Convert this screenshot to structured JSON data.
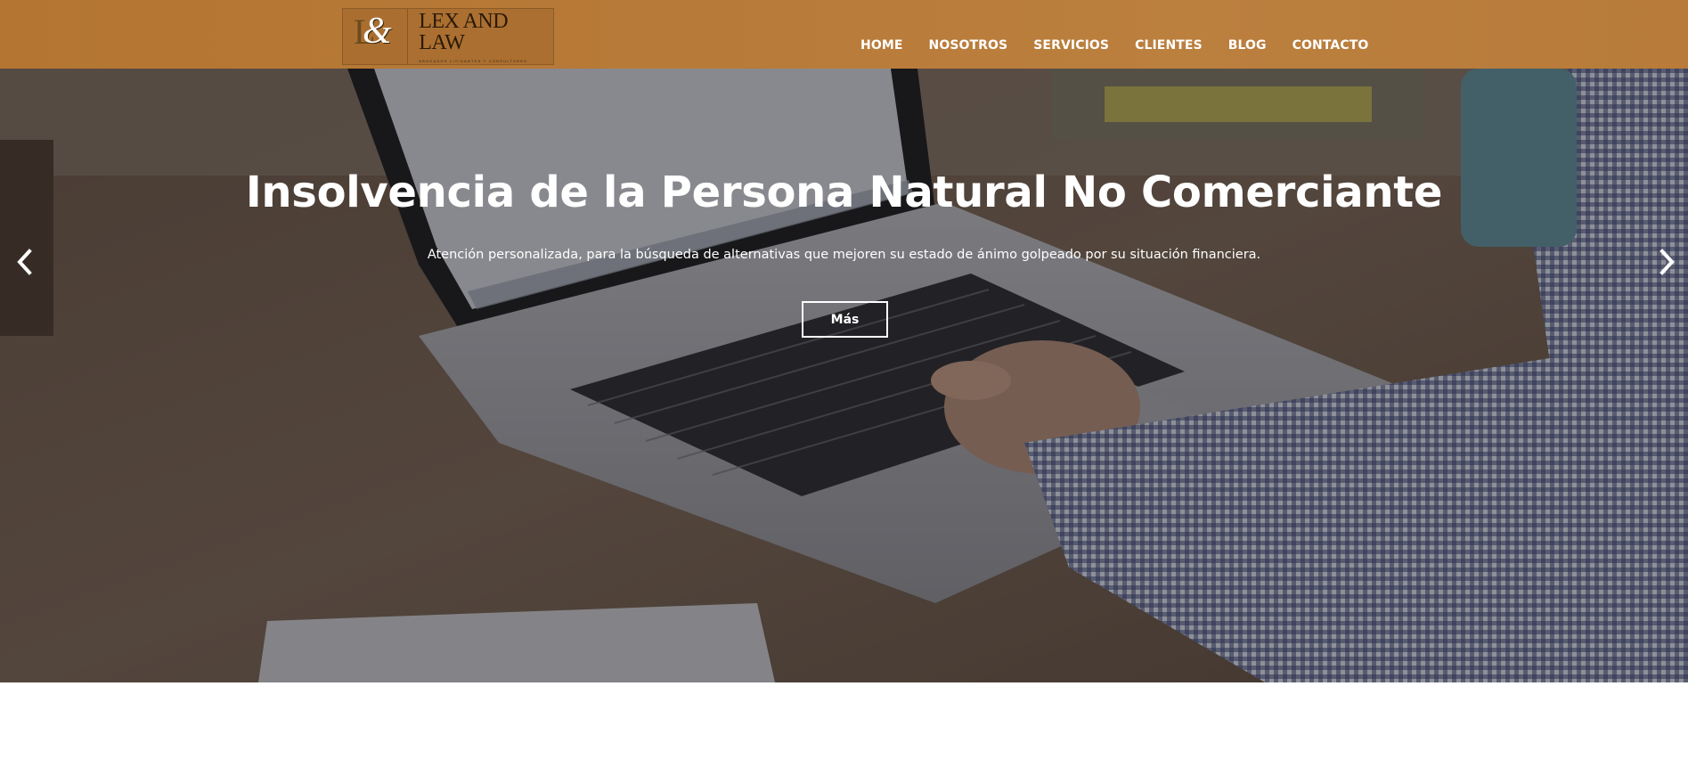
{
  "header": {
    "logo": {
      "monogram": "L&",
      "name": "LEX AND LAW",
      "tagline": "ABOGADOS LITIGANTES Y CONSULTORES"
    },
    "nav": [
      {
        "label": "HOME"
      },
      {
        "label": "NOSOTROS"
      },
      {
        "label": "SERVICIOS"
      },
      {
        "label": "CLIENTES"
      },
      {
        "label": "BLOG"
      },
      {
        "label": "CONTACTO"
      }
    ]
  },
  "hero": {
    "title": "Insolvencia de la Persona Natural No Comerciante",
    "subtitle": "Atención personalizada, para la búsqueda de alternativas que mejoren su estado de ánimo golpeado por su situación financiera.",
    "button_label": "Más",
    "prev_icon": "chevron-left-icon",
    "next_icon": "chevron-right-icon"
  },
  "colors": {
    "header_bg": "#b87a38",
    "overlay": "#1e1e22",
    "text": "#ffffff"
  }
}
